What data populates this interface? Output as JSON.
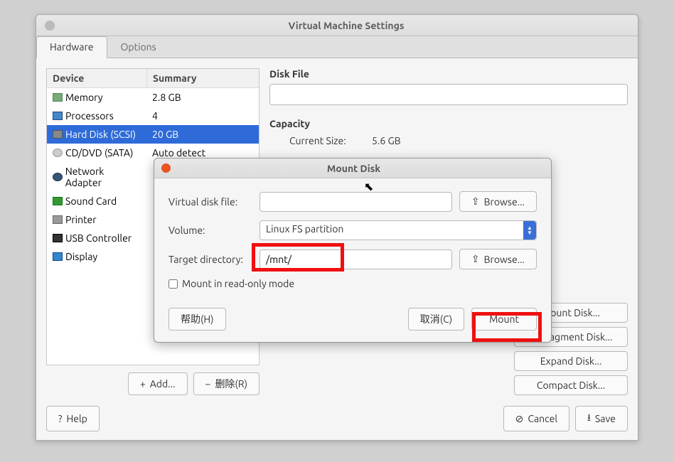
{
  "window": {
    "title": "Virtual Machine Settings",
    "tabs": [
      "Hardware",
      "Options"
    ]
  },
  "device_table": {
    "headers": [
      "Device",
      "Summary"
    ],
    "rows": [
      {
        "name": "Memory",
        "summary": "2.8 GB",
        "icon": "ico-mem"
      },
      {
        "name": "Processors",
        "summary": "4",
        "icon": "ico-cpu"
      },
      {
        "name": "Hard Disk (SCSI)",
        "summary": "20 GB",
        "icon": "ico-disk",
        "selected": true
      },
      {
        "name": "CD/DVD (SATA)",
        "summary": "Auto detect",
        "icon": "ico-cd"
      },
      {
        "name": "Network Adapter",
        "summary": "",
        "icon": "ico-net"
      },
      {
        "name": "Sound Card",
        "summary": "",
        "icon": "ico-snd"
      },
      {
        "name": "Printer",
        "summary": "",
        "icon": "ico-prn"
      },
      {
        "name": "USB Controller",
        "summary": "",
        "icon": "ico-usb"
      },
      {
        "name": "Display",
        "summary": "",
        "icon": "ico-disp"
      }
    ]
  },
  "left_buttons": {
    "add": "Add...",
    "remove": "删除(R)"
  },
  "right_panel": {
    "disk_file_label": "Disk File",
    "disk_file_value": "",
    "capacity_label": "Capacity",
    "current_size_label": "Current Size:",
    "current_size_value": "5.6 GB",
    "utilities": [
      "Mount Disk...",
      "Defragment Disk...",
      "Expand Disk...",
      "Compact Disk..."
    ]
  },
  "footer": {
    "help": "Help",
    "cancel": "Cancel",
    "save": "Save"
  },
  "dialog": {
    "title": "Mount Disk",
    "vdisk_label": "Virtual disk file:",
    "vdisk_value": "",
    "volume_label": "Volume:",
    "volume_value": "Linux FS partition",
    "target_label": "Target directory:",
    "target_value": "/mnt/",
    "readonly_label": "Mount in read-only mode",
    "browse": "Browse...",
    "help": "帮助(H)",
    "cancel": "取消(C)",
    "mount": "Mount"
  }
}
